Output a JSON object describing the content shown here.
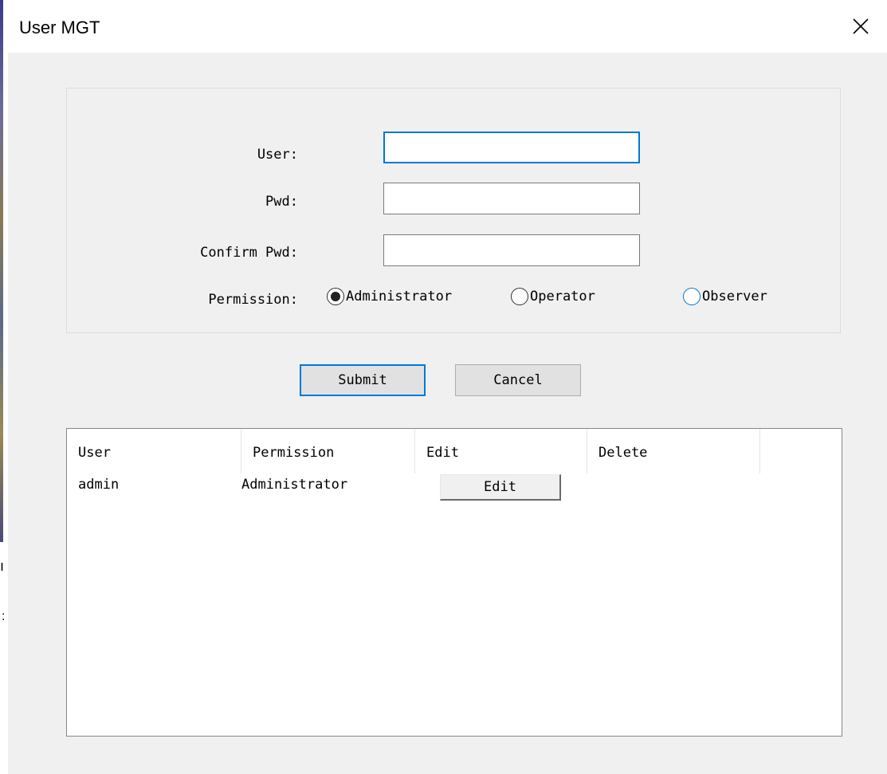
{
  "window": {
    "title": "User MGT"
  },
  "form": {
    "user_label": "User:",
    "user_value": "",
    "pwd_label": "Pwd:",
    "pwd_value": "",
    "confirm_label": "Confirm Pwd:",
    "confirm_value": "",
    "permission_label": "Permission:",
    "permission_options": [
      "Administrator",
      "Operator",
      "Observer"
    ],
    "permission_selected": "Administrator"
  },
  "buttons": {
    "submit": "Submit",
    "cancel": "Cancel"
  },
  "table": {
    "columns": [
      "User",
      "Permission",
      "Edit",
      "Delete"
    ],
    "rows": [
      {
        "user": "admin",
        "permission": "Administrator",
        "edit_label": "Edit"
      }
    ]
  },
  "icons": {
    "close": "close-icon"
  },
  "colors": {
    "focus_accent": "#0078d7"
  }
}
